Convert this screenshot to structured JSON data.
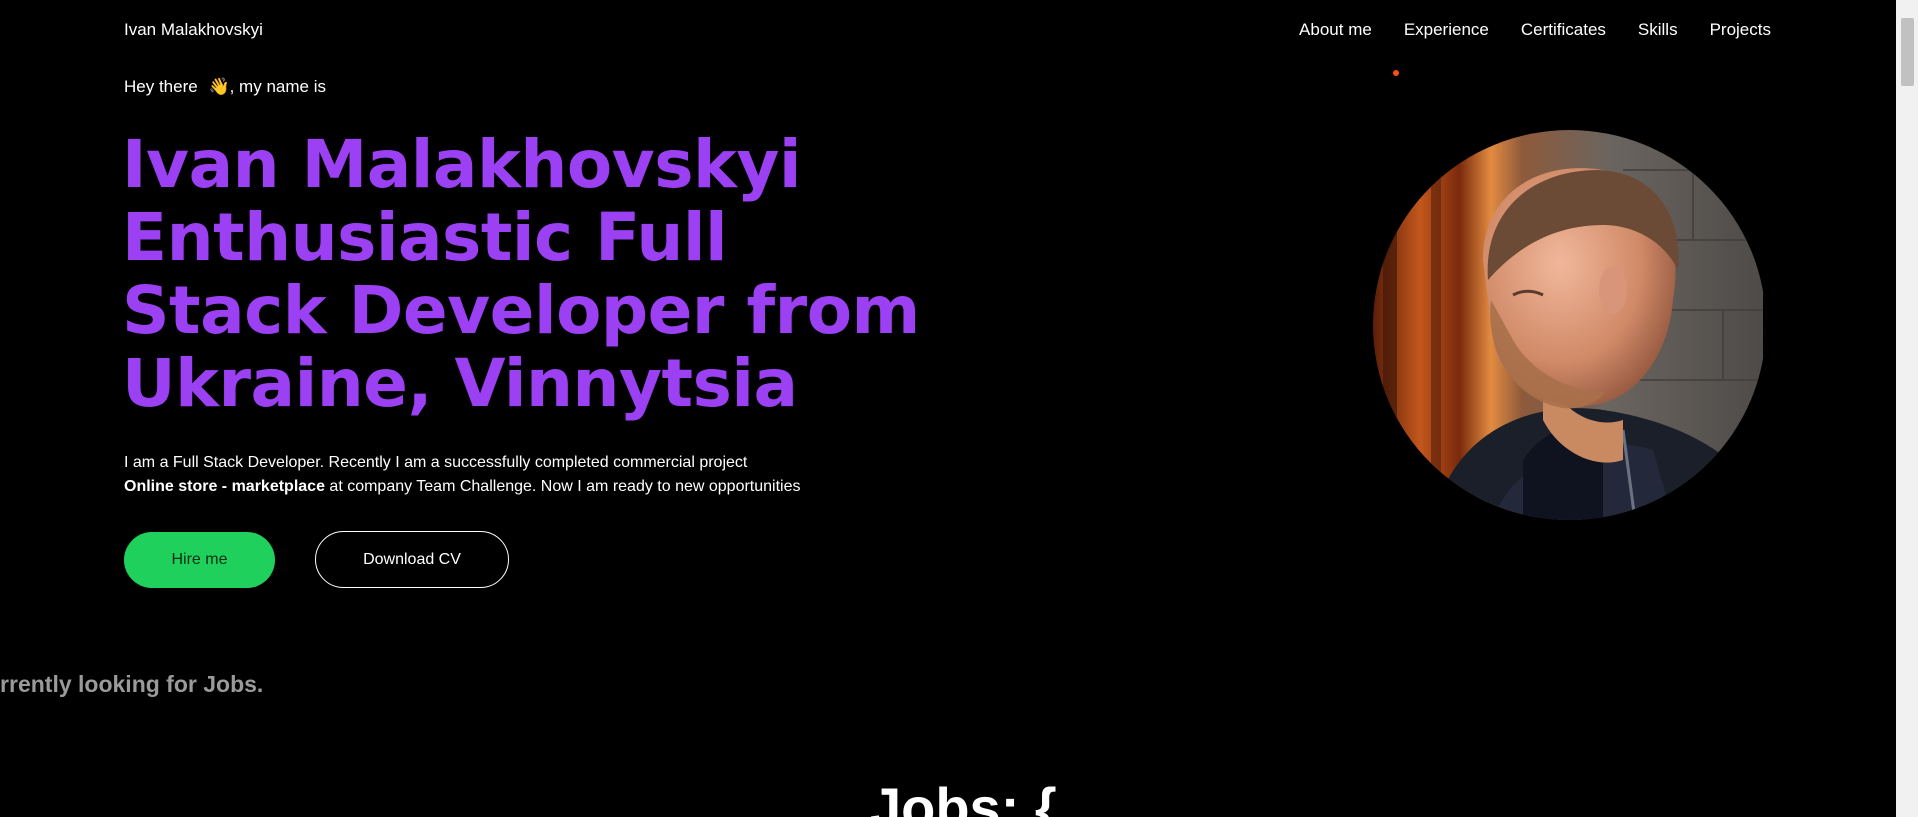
{
  "header": {
    "brand": "Ivan Malakhovskyi",
    "nav": [
      "About me",
      "Experience",
      "Certificates",
      "Skills",
      "Projects"
    ]
  },
  "hero": {
    "greeting_prefix": "Hey there",
    "greeting_emoji": "👋",
    "greeting_suffix": ", my name is",
    "title_lines": [
      "Ivan Malakhovskyi",
      "Enthusiastic Full",
      "Stack Developer from",
      "Ukraine, Vinnytsia"
    ],
    "intro_line1": "I am a Full Stack Developer. Recently I am a successfully completed commercial project",
    "intro_bold": "Online store - marketplace",
    "intro_line2_rest": " at company Team Challenge. Now I am ready to new opportunities",
    "hire_label": "Hire me",
    "cv_label": "Download CV",
    "avatar_icon": "portrait-photo"
  },
  "marquee": {
    "text": "urrently looking for Jobs."
  },
  "jobs": {
    "heading": "Jobs: {"
  },
  "colors": {
    "accent_purple": "#9b40f2",
    "hire_green": "#1fd15c",
    "indicator_orange": "#ff4d1a",
    "background": "#000000"
  }
}
